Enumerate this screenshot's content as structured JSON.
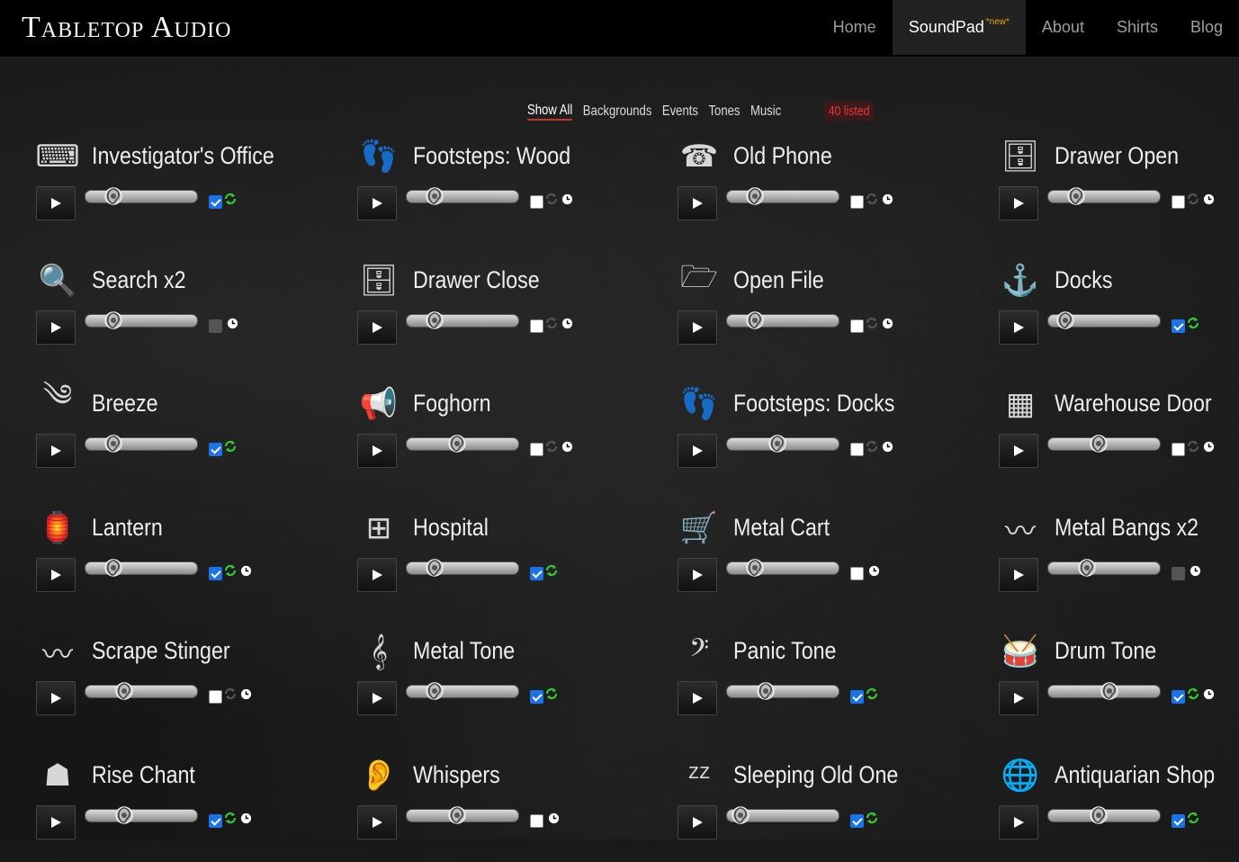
{
  "app": {
    "logo": "Tabletop Audio",
    "nav": [
      {
        "label": "Home",
        "active": false,
        "badge": ""
      },
      {
        "label": "SoundPad",
        "active": true,
        "badge": "*new*"
      },
      {
        "label": "About",
        "active": false,
        "badge": ""
      },
      {
        "label": "Shirts",
        "active": false,
        "badge": ""
      },
      {
        "label": "Blog",
        "active": false,
        "badge": ""
      }
    ]
  },
  "filters": {
    "items": [
      {
        "label": "Show All",
        "active": true
      },
      {
        "label": "Backgrounds",
        "active": false
      },
      {
        "label": "Events",
        "active": false
      },
      {
        "label": "Tones",
        "active": false
      },
      {
        "label": "Music",
        "active": false
      }
    ],
    "count": "40 listed"
  },
  "colors": {
    "loop_active": "#33cc33",
    "loop_inactive": "#555555",
    "checkbox_checked": "#1a73e8",
    "count_text": "#ee3333"
  },
  "sounds": [
    {
      "name": "Investigator's Office",
      "icon": "typewriter-icon",
      "volume": 0.25,
      "checkbox": "checked",
      "loop": "active",
      "clock": false
    },
    {
      "name": "Footsteps: Wood",
      "icon": "footprints-icon",
      "volume": 0.25,
      "checkbox": "unchecked",
      "loop": "inactive",
      "clock": true
    },
    {
      "name": "Old Phone",
      "icon": "old-phone-icon",
      "volume": 0.25,
      "checkbox": "unchecked",
      "loop": "inactive",
      "clock": true
    },
    {
      "name": "Drawer Open",
      "icon": "file-drawer-icon",
      "volume": 0.25,
      "checkbox": "unchecked",
      "loop": "inactive",
      "clock": true
    },
    {
      "name": "Search x2",
      "icon": "magnifier-icon",
      "volume": 0.25,
      "checkbox": "disabled",
      "loop": "none",
      "clock": true
    },
    {
      "name": "Drawer Close",
      "icon": "file-drawer-icon",
      "volume": 0.25,
      "checkbox": "unchecked",
      "loop": "inactive",
      "clock": true
    },
    {
      "name": "Open File",
      "icon": "folder-open-icon",
      "volume": 0.25,
      "checkbox": "unchecked",
      "loop": "inactive",
      "clock": true
    },
    {
      "name": "Docks",
      "icon": "dock-icon",
      "volume": 0.15,
      "checkbox": "checked",
      "loop": "active",
      "clock": false
    },
    {
      "name": "Breeze",
      "icon": "wind-icon",
      "volume": 0.25,
      "checkbox": "checked",
      "loop": "active",
      "clock": false
    },
    {
      "name": "Foghorn",
      "icon": "megaphone-icon",
      "volume": 0.45,
      "checkbox": "unchecked",
      "loop": "inactive",
      "clock": true
    },
    {
      "name": "Footsteps: Docks",
      "icon": "footprints-icon",
      "volume": 0.45,
      "checkbox": "unchecked",
      "loop": "inactive",
      "clock": true
    },
    {
      "name": "Warehouse Door",
      "icon": "gate-icon",
      "volume": 0.45,
      "checkbox": "unchecked",
      "loop": "inactive",
      "clock": true
    },
    {
      "name": "Lantern",
      "icon": "lantern-icon",
      "volume": 0.25,
      "checkbox": "checked",
      "loop": "active",
      "clock": true
    },
    {
      "name": "Hospital",
      "icon": "medical-cross-icon",
      "volume": 0.25,
      "checkbox": "checked",
      "loop": "active",
      "clock": false
    },
    {
      "name": "Metal Cart",
      "icon": "cart-icon",
      "volume": 0.25,
      "checkbox": "unchecked",
      "loop": "none",
      "clock": true
    },
    {
      "name": "Metal Bangs x2",
      "icon": "waveform-icon",
      "volume": 0.35,
      "checkbox": "disabled",
      "loop": "none",
      "clock": true
    },
    {
      "name": "Scrape Stinger",
      "icon": "waveform-icon",
      "volume": 0.35,
      "checkbox": "unchecked",
      "loop": "inactive",
      "clock": true
    },
    {
      "name": "Metal Tone",
      "icon": "treble-clef-icon",
      "volume": 0.25,
      "checkbox": "checked",
      "loop": "active",
      "clock": false
    },
    {
      "name": "Panic Tone",
      "icon": "bass-clef-icon",
      "volume": 0.35,
      "checkbox": "checked",
      "loop": "active",
      "clock": false
    },
    {
      "name": "Drum Tone",
      "icon": "drum-icon",
      "volume": 0.55,
      "checkbox": "checked",
      "loop": "active",
      "clock": true
    },
    {
      "name": "Rise Chant",
      "icon": "hooded-figure-icon",
      "volume": 0.35,
      "checkbox": "checked",
      "loop": "active",
      "clock": true
    },
    {
      "name": "Whispers",
      "icon": "ear-icon",
      "volume": 0.45,
      "checkbox": "unchecked",
      "loop": "none",
      "clock": true
    },
    {
      "name": "Sleeping Old One",
      "icon": "zzz-icon",
      "volume": 0.12,
      "checkbox": "checked",
      "loop": "active",
      "clock": false
    },
    {
      "name": "Antiquarian Shop",
      "icon": "globe-icon",
      "volume": 0.45,
      "checkbox": "checked",
      "loop": "active",
      "clock": false
    }
  ]
}
